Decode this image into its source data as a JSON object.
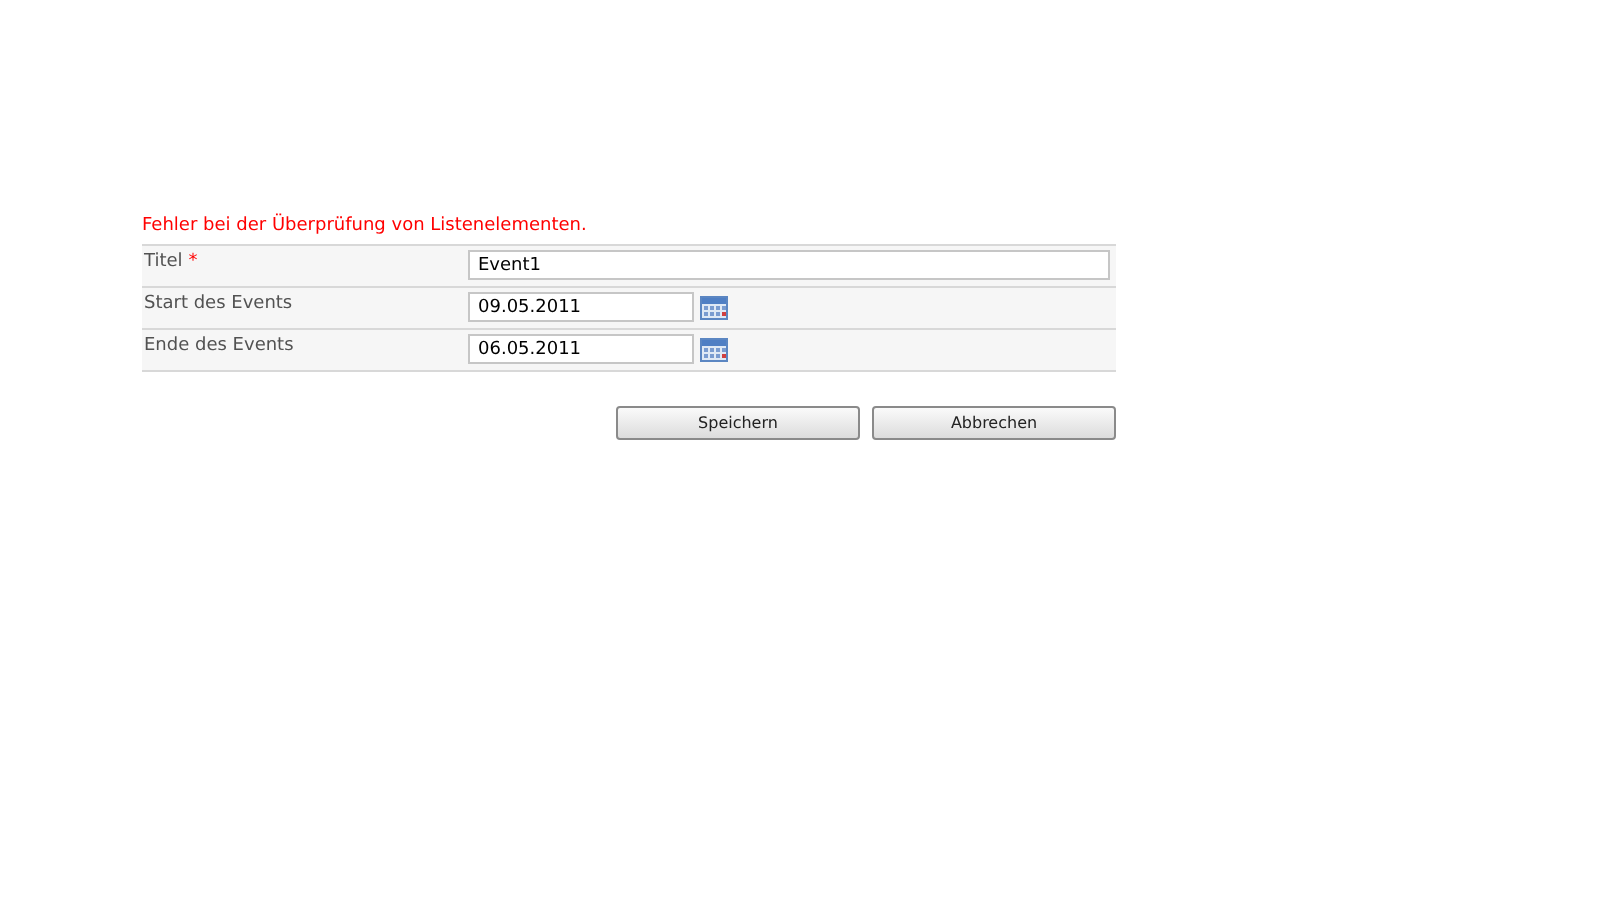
{
  "error_message": "Fehler bei der Überprüfung von Listenelementen.",
  "fields": [
    {
      "label": "Titel",
      "required": true,
      "kind": "text",
      "value": "Event1"
    },
    {
      "label": "Start des Events",
      "required": false,
      "kind": "date",
      "value": "09.05.2011"
    },
    {
      "label": "Ende des Events",
      "required": false,
      "kind": "date",
      "value": "06.05.2011"
    }
  ],
  "required_mark": "*",
  "buttons": [
    "Speichern",
    "Abbrechen"
  ]
}
